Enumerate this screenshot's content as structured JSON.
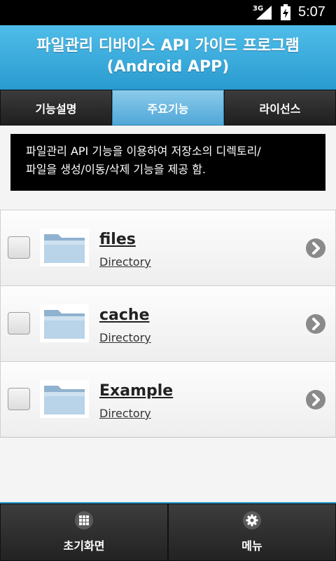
{
  "status": {
    "network": "3G",
    "time": "5:07"
  },
  "header": {
    "title_line1": "파일관리 디바이스 API 가이드 프로그램",
    "title_line2": "(Android APP)"
  },
  "tabs": [
    {
      "label": "기능설명",
      "active": false
    },
    {
      "label": "주요기능",
      "active": true
    },
    {
      "label": "라이선스",
      "active": false
    }
  ],
  "description": {
    "line1": "파일관리 API 기능을 이용하여 저장소의 디렉토리/",
    "line2": "파일을 생성/이동/삭제 기능을 제공 함."
  },
  "files": [
    {
      "name": "files",
      "type": "Directory",
      "icon": "folder-icon"
    },
    {
      "name": "cache",
      "type": "Directory",
      "icon": "folder-icon"
    },
    {
      "name": "Example",
      "type": "Directory",
      "icon": "folder-icon"
    }
  ],
  "footer": {
    "home_label": "초기화면",
    "home_icon": "grid-icon",
    "menu_label": "메뉴",
    "menu_icon": "gear-icon"
  },
  "colors": {
    "header": "#2a9bd0",
    "active_tab": "#5fb2de",
    "footer": "#222222"
  }
}
